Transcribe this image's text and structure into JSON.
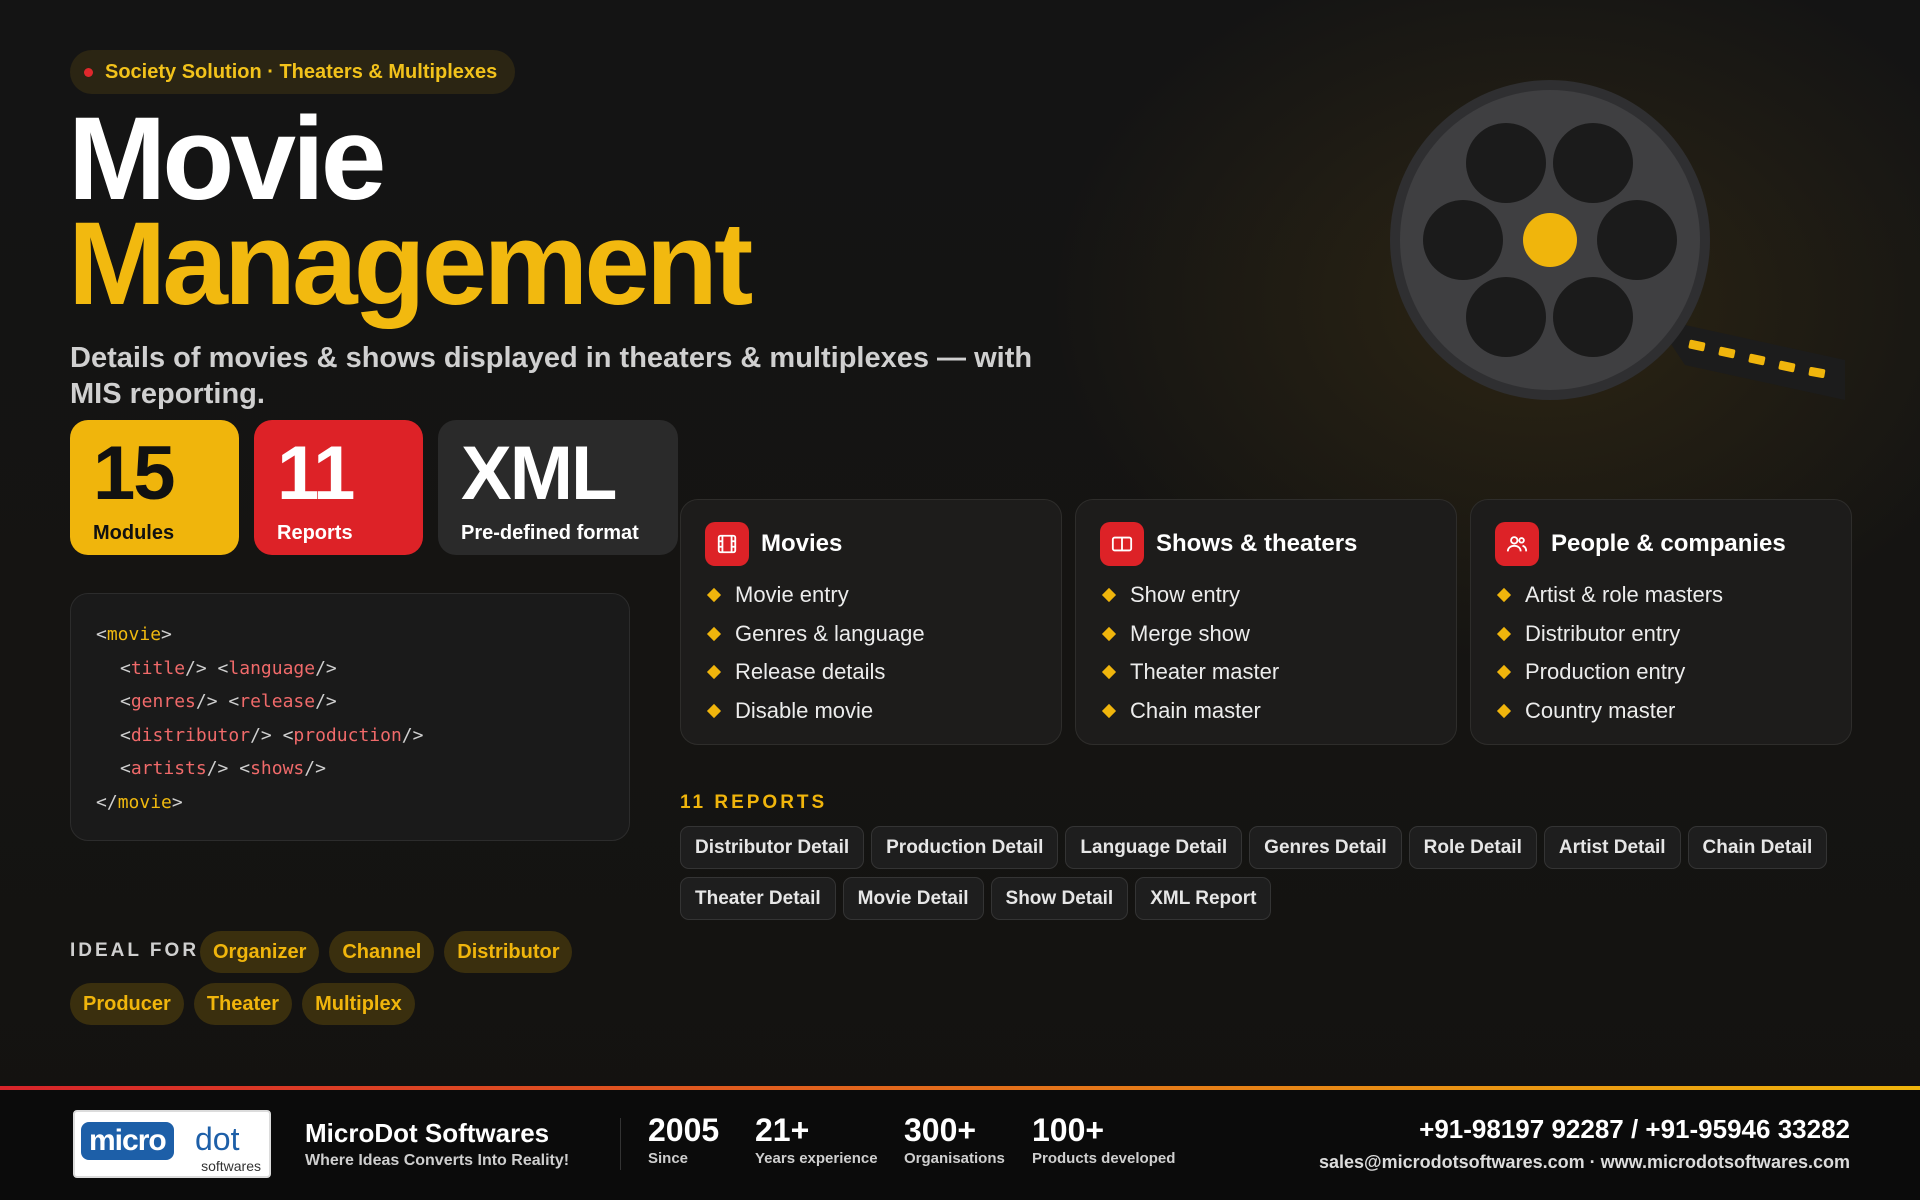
{
  "badge": {
    "text": "Society Solution · Theaters & Multiplexes"
  },
  "hero": {
    "title_line1": "Movie",
    "title_line2": "Management",
    "subtitle": "Details of movies & shows displayed in theaters & multiplexes — with MIS reporting."
  },
  "stats_tiles": [
    {
      "value": "15",
      "label": "Modules"
    },
    {
      "value": "11",
      "label": "Reports"
    },
    {
      "value": "XML",
      "label": "Pre-defined format"
    }
  ],
  "code": {
    "open": "movie",
    "rows": [
      [
        "title",
        "language"
      ],
      [
        "genres",
        "release"
      ],
      [
        "distributor",
        "production"
      ],
      [
        "artists",
        "shows"
      ]
    ],
    "close": "movie"
  },
  "cards": [
    {
      "title": "Movies",
      "icon": "film-icon",
      "items": [
        "Movie entry",
        "Genres & language",
        "Release details",
        "Disable movie"
      ]
    },
    {
      "title": "Shows & theaters",
      "icon": "screens-icon",
      "items": [
        "Show entry",
        "Merge show",
        "Theater master",
        "Chain master"
      ]
    },
    {
      "title": "People & companies",
      "icon": "people-icon",
      "items": [
        "Artist & role masters",
        "Distributor entry",
        "Production entry",
        "Country master"
      ]
    }
  ],
  "reports": {
    "heading": "11 REPORTS",
    "items": [
      "Distributor Detail",
      "Production Detail",
      "Language Detail",
      "Genres Detail",
      "Role Detail",
      "Artist Detail",
      "Chain Detail",
      "Theater Detail",
      "Movie Detail",
      "Show Detail",
      "XML Report"
    ]
  },
  "ideal_for": {
    "label": "IDEAL FOR",
    "items": [
      "Organizer",
      "Channel",
      "Distributor",
      "Producer",
      "Theater",
      "Multiplex"
    ]
  },
  "colors": {
    "accent_yellow": "#f0b50c",
    "accent_red": "#dd2227",
    "background": "#121212"
  },
  "footer": {
    "logo": {
      "part1": "micro",
      "part2": "dot",
      "part3": "softwares"
    },
    "company": "MicroDot Softwares",
    "tagline": "Where Ideas Converts Into Reality!",
    "stats": [
      {
        "value": "2005",
        "label": "Since"
      },
      {
        "value": "21+",
        "label": "Years experience"
      },
      {
        "value": "300+",
        "label": "Organisations"
      },
      {
        "value": "100+",
        "label": "Products developed"
      }
    ],
    "phone": "+91-98197 92287 / +91-95946 33282",
    "contact": "sales@microdotsoftwares.com · www.microdotsoftwares.com"
  }
}
